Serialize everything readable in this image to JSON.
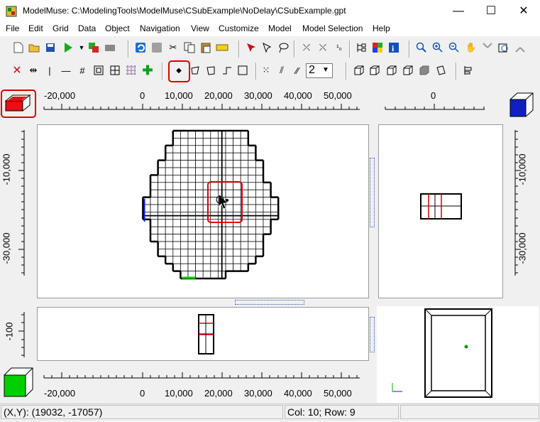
{
  "window": {
    "title": "ModelMuse: C:\\ModelingTools\\ModelMuse\\CSubExample\\NoDelay\\CSubExample.gpt",
    "minimize_glyph": "—",
    "maximize_glyph": "☐",
    "close_glyph": "✕"
  },
  "menu": {
    "items": [
      "File",
      "Edit",
      "Grid",
      "Data",
      "Object",
      "Navigation",
      "View",
      "Customize",
      "Model",
      "Model Selection",
      "Help"
    ]
  },
  "toolbar": {
    "layer_spin_value": "2"
  },
  "top_ruler": {
    "labels": [
      "-20,000",
      "0",
      "10,000",
      "20,000",
      "30,000",
      "40,000",
      "50,000"
    ]
  },
  "side_top_ruler": {
    "labels": [
      "0"
    ]
  },
  "left_ruler": {
    "labels": [
      "-10,000",
      "-30,000"
    ]
  },
  "right_ruler": {
    "labels": [
      "-10,000",
      "-30,000"
    ]
  },
  "front_left_ruler": {
    "labels": [
      "-100"
    ]
  },
  "bottom_ruler": {
    "labels": [
      "-20,000",
      "0",
      "10,000",
      "20,000",
      "30,000",
      "40,000",
      "50,000"
    ]
  },
  "status": {
    "xy": "(X,Y): (19032, -17057)",
    "col_row": "Col: 10; Row: 9"
  },
  "colors": {
    "highlight": "#e00000",
    "cell_top_icon": "#e81010",
    "cell_bottom_icon": "#00d000",
    "cube_icon": "#1020c0",
    "grid_line": "#000000"
  }
}
